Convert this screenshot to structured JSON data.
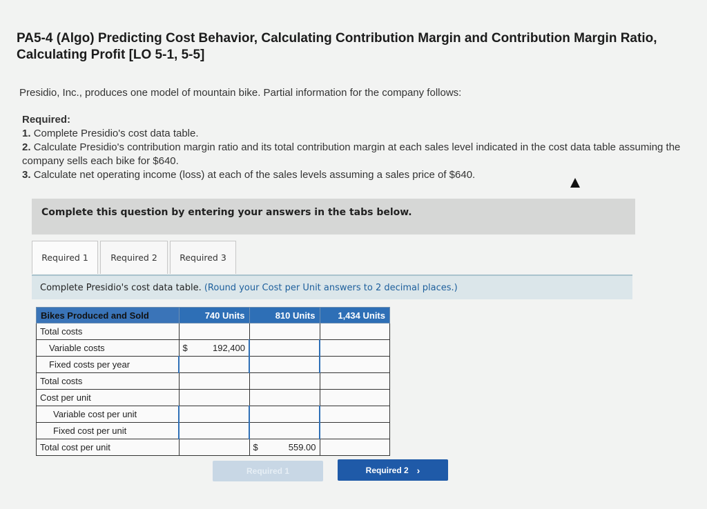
{
  "header": {
    "title": "PA5-4 (Algo) Predicting Cost Behavior, Calculating Contribution Margin and Contribution Margin Ratio, Calculating Profit [LO 5-1, 5-5]"
  },
  "intro": "Presidio, Inc., produces one model of mountain bike. Partial information for the company follows:",
  "required": {
    "heading": "Required:",
    "items": [
      {
        "num": "1.",
        "text": "Complete Presidio's cost data table."
      },
      {
        "num": "2.",
        "text": "Calculate Presidio's contribution margin ratio and its total contribution margin at each sales level indicated in the cost data table assuming the company sells each bike for $640."
      },
      {
        "num": "3.",
        "text": "Calculate net operating income (loss) at each of the sales levels assuming a sales price of $640."
      }
    ]
  },
  "banner": "Complete this question by entering your answers in the tabs below.",
  "tabs": [
    {
      "label": "Required 1"
    },
    {
      "label": "Required 2"
    },
    {
      "label": "Required 3"
    }
  ],
  "instruction": {
    "text": "Complete Presidio's cost data table.",
    "note": "(Round your Cost per Unit answers to 2 decimal places.)"
  },
  "table": {
    "headers": [
      "Bikes Produced and Sold",
      "740 Units",
      "810 Units",
      "1,434 Units"
    ],
    "rows": [
      {
        "label": "Total costs",
        "cells": [
          "",
          "",
          ""
        ]
      },
      {
        "label": "Variable costs",
        "cells": [
          "192,400",
          "",
          ""
        ]
      },
      {
        "label": "Fixed costs per year",
        "cells": [
          "",
          "",
          ""
        ]
      },
      {
        "label": "Total costs",
        "cells": [
          "",
          "",
          ""
        ]
      },
      {
        "label": "Cost per unit",
        "cells": [
          "",
          "",
          ""
        ]
      },
      {
        "label": "Variable cost per unit",
        "cells": [
          "",
          "",
          ""
        ]
      },
      {
        "label": "Fixed cost per unit",
        "cells": [
          "",
          "",
          ""
        ]
      },
      {
        "label": "Total cost per unit",
        "cells": [
          "",
          "559.00",
          ""
        ]
      }
    ],
    "currency": "$"
  },
  "nav": {
    "prev_label": "Required 1",
    "next_label": "Required 2",
    "next_icon": "chevron-right-icon"
  }
}
